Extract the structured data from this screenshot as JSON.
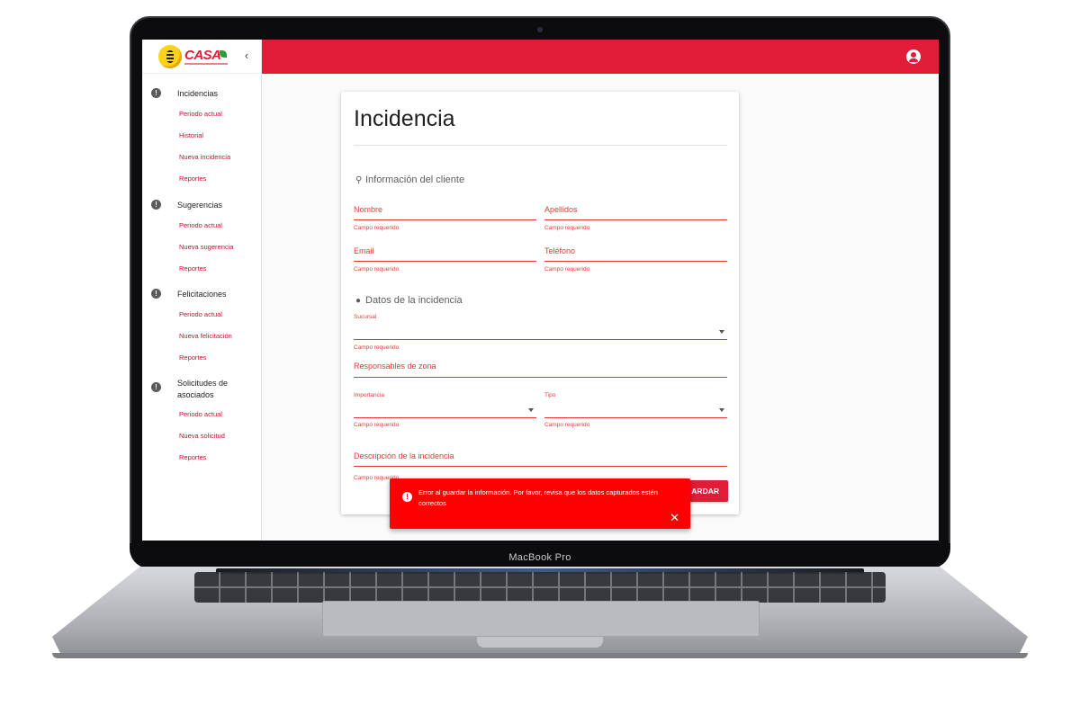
{
  "device": {
    "label": "MacBook Pro"
  },
  "brand": {
    "name": "CASA"
  },
  "sidebar": {
    "sections": [
      {
        "label": "Incidencias",
        "items": [
          "Periodo actual",
          "Historial",
          "Nueva incidencia",
          "Reportes"
        ]
      },
      {
        "label": "Sugerencias",
        "items": [
          "Periodo actual",
          "Nueva sugerencia",
          "Reportes"
        ]
      },
      {
        "label": "Felicitaciones",
        "items": [
          "Periodo actual",
          "Nueva felicitación",
          "Reportes"
        ]
      },
      {
        "label": "Solicitudes de asociados",
        "items": [
          "Periodo actual",
          "Nueva solicitud",
          "Reportes"
        ]
      }
    ]
  },
  "form": {
    "title": "Incidencia",
    "section_client": "Información del cliente",
    "section_incident": "Datos de la incidencia",
    "required_msg": "Campo requerido",
    "fields": {
      "nombre": "Nombre",
      "apellidos": "Apellidos",
      "email": "Email",
      "telefono": "Teléfono",
      "sucursal": "Sucursal",
      "responsables": "Responsables de zona",
      "importancia": "Importancia",
      "tipo": "Tipo",
      "descripcion": "Descripción de la incidencia"
    },
    "save_label": "ARDAR"
  },
  "snackbar": {
    "message": "Error al guardar la información. Por favor, revisa que los datos capturados estén correctos",
    "color": "#ff0000"
  },
  "colors": {
    "accent": "#e01c38",
    "error": "#e53935"
  }
}
